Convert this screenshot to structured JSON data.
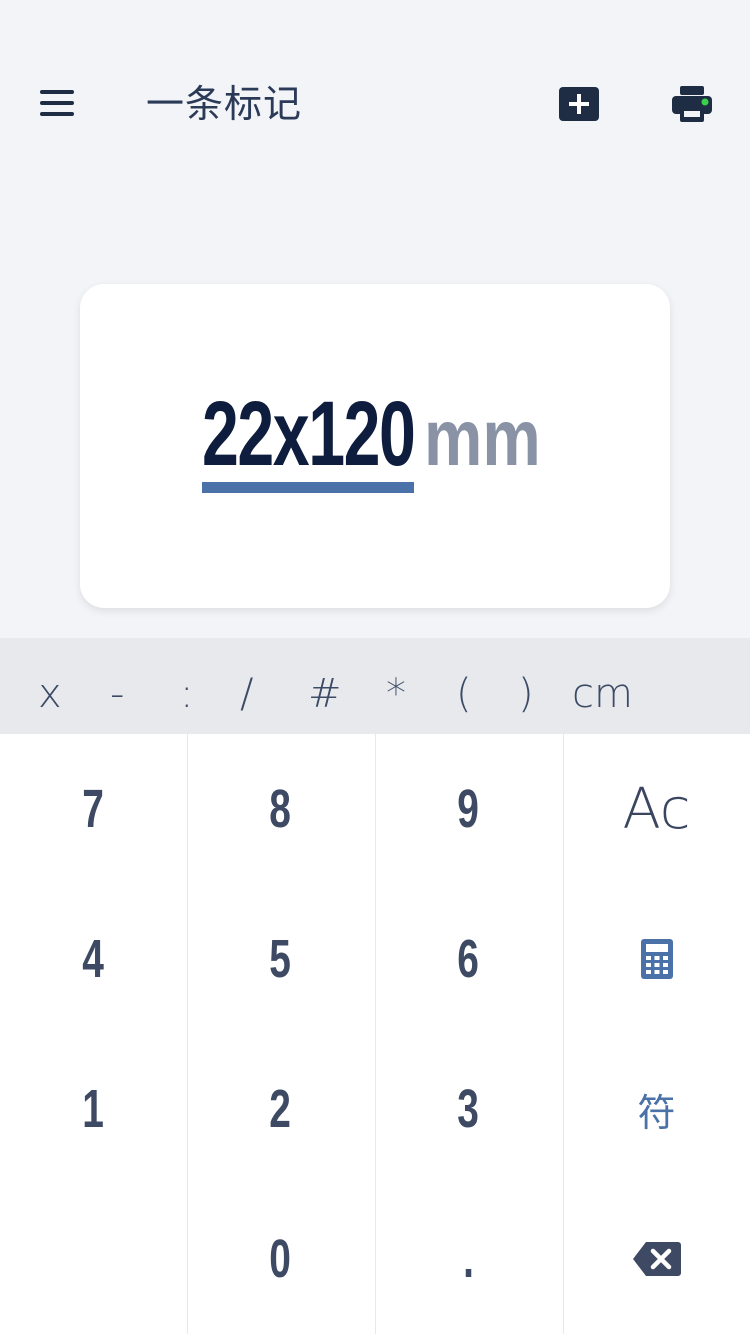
{
  "header": {
    "title": "一条标记",
    "menu_icon": "hamburger-menu-icon",
    "add_icon": "add-square-icon",
    "print_icon": "printer-icon",
    "print_status_color": "#3ad14a"
  },
  "display": {
    "value": "22x120",
    "unit": "mm",
    "underline_color": "#4a72a8"
  },
  "symbols": [
    "x",
    "-",
    ":",
    "/",
    "#",
    "*",
    "(",
    ")",
    "cm"
  ],
  "keypad": {
    "digits": {
      "k7": "7",
      "k8": "8",
      "k9": "9",
      "k4": "4",
      "k5": "5",
      "k6": "6",
      "k1": "1",
      "k2": "2",
      "k3": "3",
      "k0": "0",
      "dot": "."
    },
    "ac_label": "Ac",
    "symbol_label": "符",
    "calculator_icon": "calculator-icon",
    "backspace_icon": "backspace-icon",
    "accent_color": "#4a72a8"
  }
}
